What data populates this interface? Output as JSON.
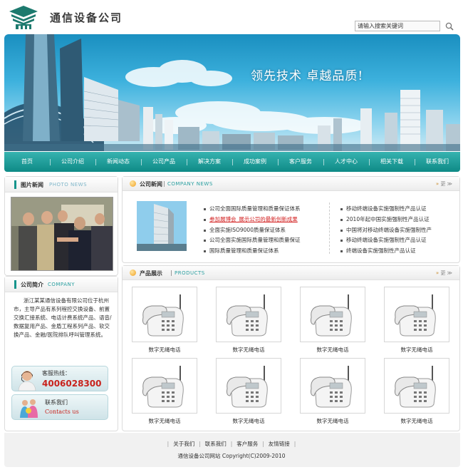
{
  "header": {
    "logo_text": "通信设备公司",
    "search_placeholder": "请输入搜索关键词"
  },
  "banner": {
    "slogan": "领先技术  卓越品质!"
  },
  "nav": {
    "items": [
      "首页",
      "公司介绍",
      "新闻动态",
      "公司产品",
      "解决方案",
      "成功案例",
      "客户服务",
      "人才中心",
      "相关下载",
      "联系我们"
    ]
  },
  "photo_news": {
    "title": "图片新闻",
    "subtitle": "PHOTO NEWS"
  },
  "company_intro": {
    "title": "公司简介",
    "subtitle": "COMPANY",
    "text": "浙江某某通信设备有限公司位于杭州市，主导产品有系列程控交换设备、前置交换汇接系统、电话计费系统产品、语音/数据复用产品、金盾工程系列产品、软交换产品、金融/医院排队呼叫管理系统。"
  },
  "hotline": {
    "label": "客服热线：",
    "number": "4006028300"
  },
  "contact": {
    "label": "联系我们",
    "sub": "Contacts us"
  },
  "company_news": {
    "title": "公司新闻",
    "subtitle": "COMPANY NEWS",
    "more": "更",
    "left_items": [
      {
        "text": "公司全面国际质量管理和质量保证体系",
        "hot": false
      },
      {
        "text": "参加展博会_展示公司的最新创新成果",
        "hot": true
      },
      {
        "text": "全面实施ISO9000质量保证体系",
        "hot": false
      },
      {
        "text": "公司全面实施国际质量管理和质量保证",
        "hot": false
      },
      {
        "text": "国际质量管理和质量保证体系",
        "hot": false
      }
    ],
    "right_items": [
      "移动终端设备实施强制性产品认证",
      "2010年起中国实施强制性产品认证",
      "中国将对移动终端设备实施强制性产",
      "移动终端设备实施强制性产品认证",
      "终端设备实施强制性产品认证"
    ]
  },
  "products": {
    "title": "产品展示",
    "subtitle": "PRODUCTS",
    "more": "更",
    "items": [
      "数字无绳电话",
      "数字无绳电话",
      "数字无绳电话",
      "数字无绳电话",
      "数字无绳电话",
      "数字无绳电话",
      "数字无绳电话",
      "数字无绳电话"
    ]
  },
  "footer": {
    "links": [
      "关于我们",
      "联系我们",
      "客户服务",
      "友情链接"
    ],
    "copyright": "通信设备公司网站  Copyright(C)2009-2010"
  }
}
